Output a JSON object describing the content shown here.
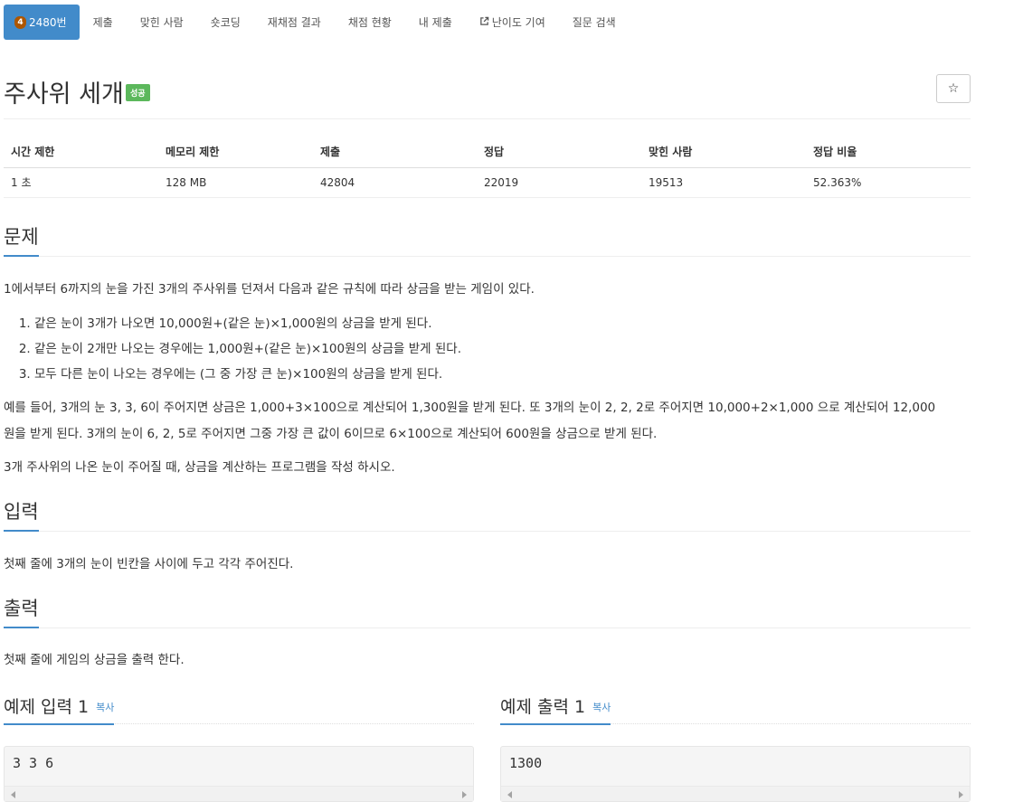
{
  "nav": {
    "tier_icon_text": "4",
    "items": [
      "2480번",
      "제출",
      "맞힌 사람",
      "숏코딩",
      "재채점 결과",
      "채점 현황",
      "내 제출",
      "난이도 기여",
      "질문 검색"
    ]
  },
  "problem": {
    "title": "주사위 세개",
    "status_badge": "성공",
    "star": "☆"
  },
  "stats": {
    "headers": [
      "시간 제한",
      "메모리 제한",
      "제출",
      "정답",
      "맞힌 사람",
      "정답 비율"
    ],
    "values": [
      "1 초",
      "128 MB",
      "42804",
      "22019",
      "19513",
      "52.363%"
    ]
  },
  "sections": {
    "description_title": "문제",
    "description_intro": "1에서부터 6까지의 눈을 가진 3개의 주사위를 던져서 다음과 같은 규칙에 따라 상금을 받는 게임이 있다.",
    "rules": [
      "같은 눈이 3개가 나오면 10,000원+(같은 눈)×1,000원의 상금을 받게 된다.",
      "같은 눈이 2개만 나오는 경우에는 1,000원+(같은 눈)×100원의 상금을 받게 된다.",
      "모두 다른 눈이 나오는 경우에는 (그 중 가장 큰 눈)×100원의 상금을 받게 된다."
    ],
    "description_example_line1": "예를 들어, 3개의 눈 3, 3, 6이 주어지면 상금은 1,000+3×100으로 계산되어 1,300원을 받게 된다. 또 3개의 눈이 2, 2, 2로 주어지면 10,000+2×1,000 으로 계산되어 12,000",
    "description_example_line2": "원을 받게 된다. 3개의 눈이 6, 2, 5로 주어지면 그중 가장 큰 값이 6이므로 6×100으로 계산되어 600원을 상금으로 받게 된다.",
    "description_task": "3개 주사위의 나온 눈이 주어질 때, 상금을 계산하는 프로그램을 작성 하시오.",
    "input_title": "입력",
    "input_text": "첫째 줄에 3개의 눈이 빈칸을 사이에 두고 각각 주어진다.",
    "output_title": "출력",
    "output_text": "첫째 줄에 게임의 상금을 출력 한다."
  },
  "examples": {
    "input_title": "예제 입력 1",
    "output_title": "예제 출력 1",
    "copy_label": "복사",
    "input_value": "3 3 6",
    "output_value": "1300"
  },
  "colors": {
    "primary": "#428bca",
    "success": "#5cb85c",
    "tier_bronze": "#ad5600"
  }
}
